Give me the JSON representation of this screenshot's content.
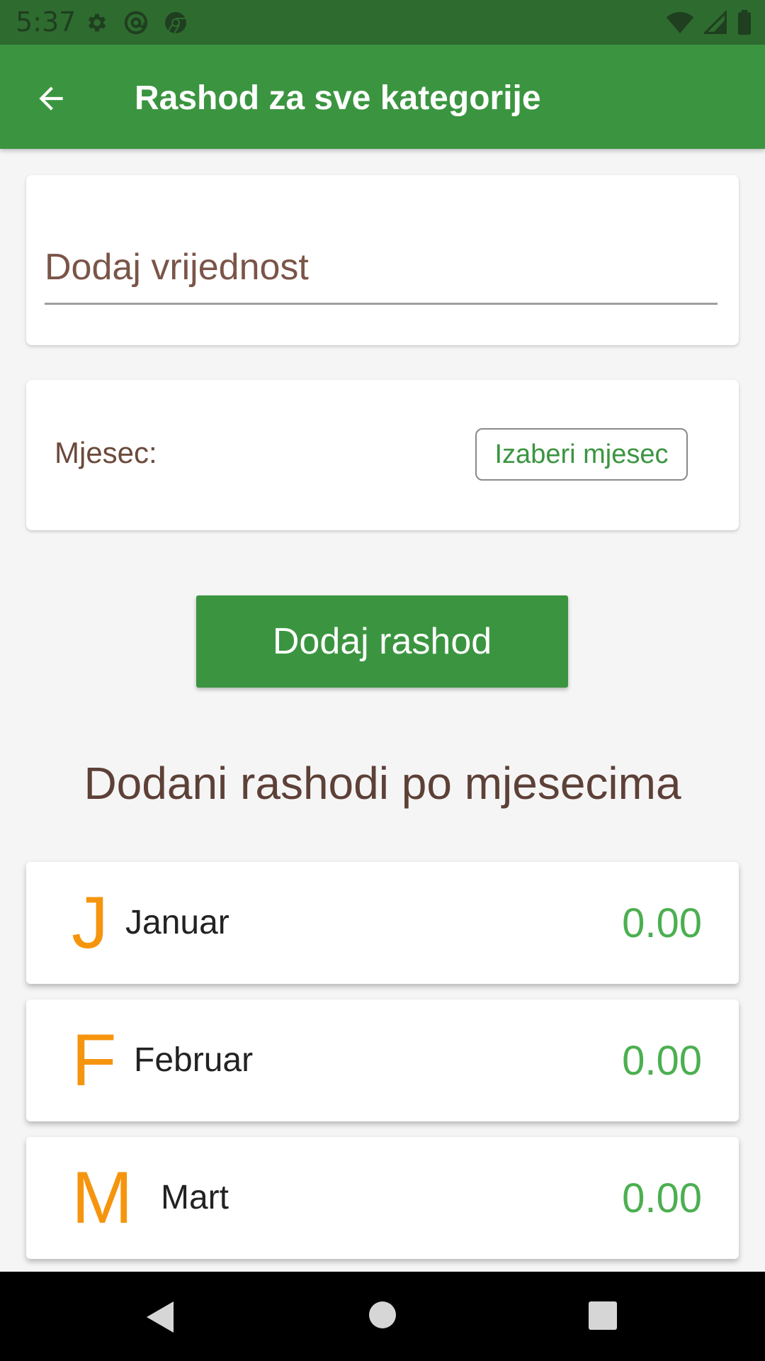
{
  "status_bar": {
    "time": "5:37",
    "left_icons": [
      "settings-icon",
      "at-sign-icon",
      "chrome-icon"
    ],
    "right_icons": [
      "wifi-icon",
      "signal-icon",
      "battery-icon"
    ]
  },
  "app_bar": {
    "title": "Rashod za sve kategorije",
    "back_icon": "arrow-back-icon"
  },
  "value_input": {
    "placeholder": "Dodaj vrijednost",
    "value": ""
  },
  "month_picker": {
    "label": "Mjesec:",
    "button_label": "Izaberi mjesec"
  },
  "add_button": {
    "label": "Dodaj rashod"
  },
  "list_section": {
    "title": "Dodani rashodi po mjesecima",
    "months": [
      {
        "letter": "J",
        "name": "Januar",
        "value": "0.00"
      },
      {
        "letter": "F",
        "name": "Februar",
        "value": "0.00"
      },
      {
        "letter": "M",
        "name": "Mart",
        "value": "0.00"
      }
    ]
  },
  "nav_bar": {
    "icons": [
      "nav-back-icon",
      "nav-home-icon",
      "nav-recents-icon"
    ]
  },
  "colors": {
    "status_bar": "#2e6b2f",
    "app_bar": "#3b9540",
    "accent_green": "#4caf50",
    "letter_orange": "#f5950e",
    "brown_text": "#5d4037"
  }
}
